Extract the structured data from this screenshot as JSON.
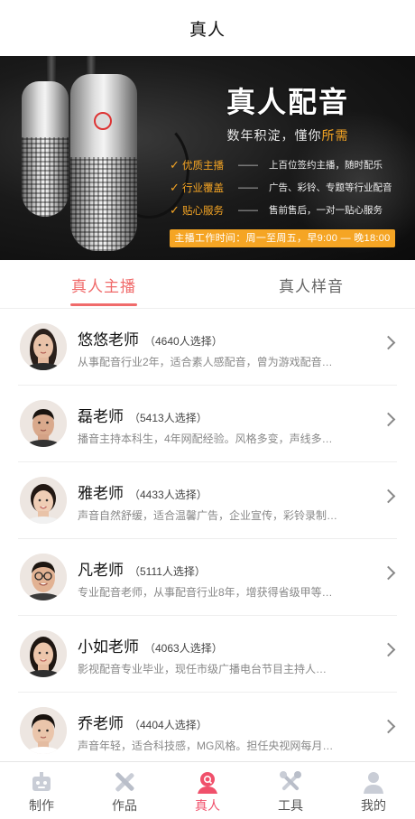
{
  "header": {
    "title": "真人"
  },
  "banner": {
    "title": "真人配音",
    "subtitle_prefix": "数年积淀，懂你",
    "subtitle_highlight": "所需",
    "features": [
      {
        "name": "优质主播",
        "dash": "——",
        "desc": "上百位签约主播，随时配乐"
      },
      {
        "name": "行业覆盖",
        "dash": "——",
        "desc": "广告、彩铃、专题等行业配音"
      },
      {
        "name": "贴心服务",
        "dash": "——",
        "desc": "售前售后，一对一贴心服务"
      }
    ],
    "hours": "主播工作时间：周一至周五，早9:00 — 晚18:00",
    "accent_color": "#f5a524"
  },
  "tabs": [
    {
      "label": "真人主播",
      "active": true
    },
    {
      "label": "真人样音",
      "active": false
    }
  ],
  "teachers": [
    {
      "name": "悠悠老师",
      "count": "（4640人选择）",
      "desc": "从事配音行业2年，适合素人感配音，曾为游戏配音…"
    },
    {
      "name": "磊老师",
      "count": "（5413人选择）",
      "desc": "播音主持本科生，4年网配经验。风格多变，声线多…"
    },
    {
      "name": "雅老师",
      "count": "（4433人选择）",
      "desc": "声音自然舒缓，适合温馨广告，企业宣传，彩铃录制…"
    },
    {
      "name": "凡老师",
      "count": "（5111人选择）",
      "desc": "专业配音老师，从事配音行业8年，增获得省级甲等…"
    },
    {
      "name": "小如老师",
      "count": "（4063人选择）",
      "desc": "影视配音专业毕业，现任市级广播电台节目主持人…"
    },
    {
      "name": "乔老师",
      "count": "（4404人选择）",
      "desc": "声音年轻，适合科技感，MG风格。担任央视网每月…"
    }
  ],
  "bottom_nav": [
    {
      "label": "制作",
      "icon": "robot-icon",
      "active": false
    },
    {
      "label": "作品",
      "icon": "tools-cross-icon",
      "active": false
    },
    {
      "label": "真人",
      "icon": "person-search-icon",
      "active": true
    },
    {
      "label": "工具",
      "icon": "wrench-icon",
      "active": false
    },
    {
      "label": "我的",
      "icon": "user-icon",
      "active": false
    }
  ],
  "colors": {
    "tab_active": "#f06b6b",
    "nav_active": "#f0506b"
  }
}
